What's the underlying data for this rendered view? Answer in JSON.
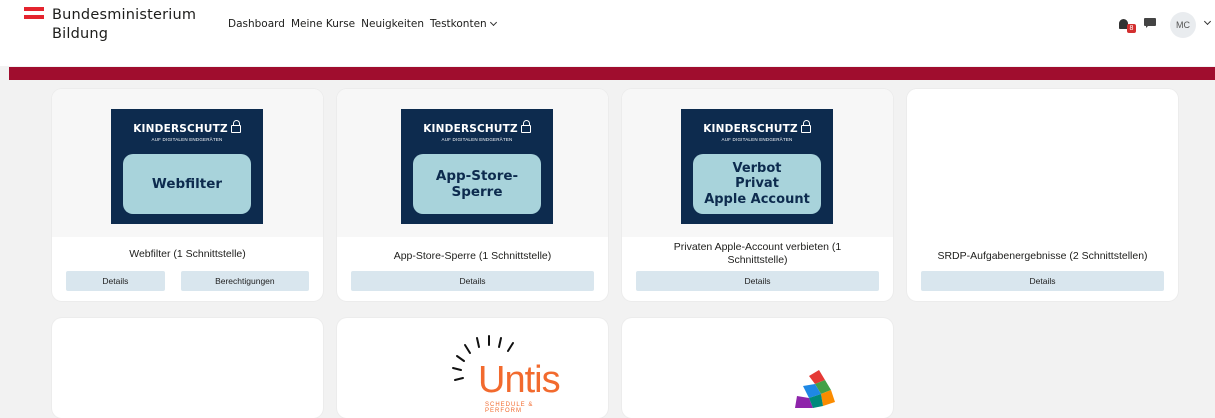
{
  "header": {
    "logo_line1": "Bundesministerium",
    "logo_line2": "Bildung",
    "nav": [
      {
        "label": "Dashboard"
      },
      {
        "label": "Meine Kurse"
      },
      {
        "label": "Neuigkeiten"
      },
      {
        "label": "Testkonten",
        "has_dropdown": true
      }
    ],
    "notification_count": "8",
    "user_initials": "MC"
  },
  "colors": {
    "accent_band": "#a00d2e",
    "logo_red": "#e4242e",
    "kinderschutz_bg": "#0d2b4e",
    "kinderschutz_box": "#a8d3db",
    "button_bg": "#d9e6ee",
    "untis_orange": "#f26a2e"
  },
  "kinderschutz": {
    "title": "KINDERSCHUTZ",
    "subtitle": "AUF DIGITALEN ENDGERÄTEN"
  },
  "cards": [
    {
      "image_label": "Webfilter",
      "title": "Webfilter (1 Schnittstelle)",
      "buttons": [
        "Details",
        "Berechtigungen"
      ]
    },
    {
      "image_label": "App-Store-\nSperre",
      "title": "App-Store-Sperre (1 Schnittstelle)",
      "buttons": [
        "Details"
      ]
    },
    {
      "image_label": "Verbot\nPrivat\nApple Account",
      "title": "Privaten Apple-Account verbieten (1 Schnittstelle)",
      "buttons": [
        "Details"
      ]
    },
    {
      "title": "SRDP-Aufgabenergebnisse (2 Schnittstellen)",
      "buttons": [
        "Details"
      ]
    }
  ],
  "untis": {
    "word": "Untis",
    "tagline": "SCHEDULE & PERFORM"
  }
}
